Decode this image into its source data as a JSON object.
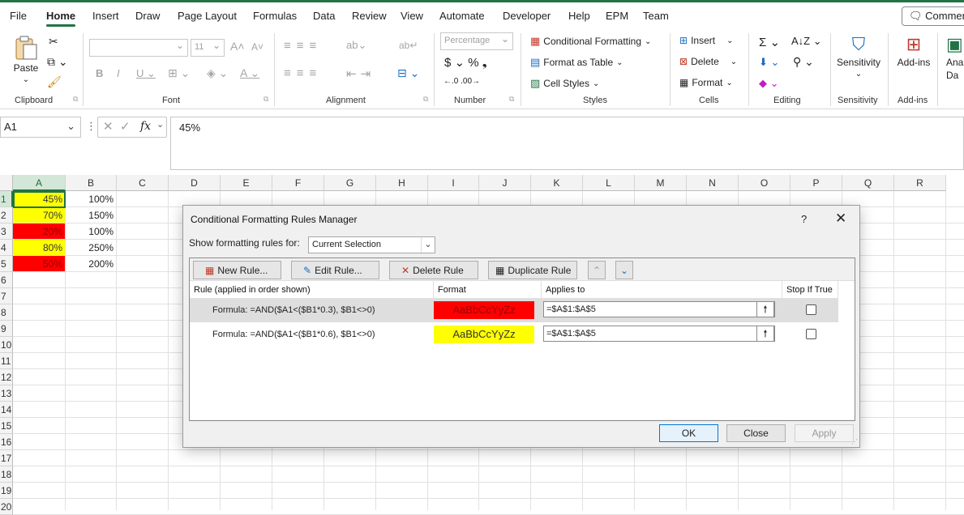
{
  "menu": {
    "tabs": [
      {
        "label": "File"
      },
      {
        "label": "Home"
      },
      {
        "label": "Insert"
      },
      {
        "label": "Draw"
      },
      {
        "label": "Page Layout"
      },
      {
        "label": "Formulas"
      },
      {
        "label": "Data"
      },
      {
        "label": "Review"
      },
      {
        "label": "View"
      },
      {
        "label": "Automate"
      },
      {
        "label": "Developer"
      },
      {
        "label": "Help"
      },
      {
        "label": "EPM"
      },
      {
        "label": "Team"
      }
    ],
    "active": "Home",
    "comments_label": "Comments"
  },
  "ribbon": {
    "clipboard": {
      "paste": "Paste",
      "label": "Clipboard"
    },
    "font": {
      "name": "",
      "size": "11",
      "label": "Font"
    },
    "alignment": {
      "label": "Alignment"
    },
    "number": {
      "format": "Percentage",
      "label": "Number"
    },
    "styles": {
      "conditional": "Conditional Formatting",
      "table": "Format as Table",
      "cell_styles": "Cell Styles",
      "label": "Styles"
    },
    "cells": {
      "insert": "Insert",
      "delete": "Delete",
      "format": "Format",
      "label": "Cells"
    },
    "editing": {
      "label": "Editing"
    },
    "sensitivity": {
      "btn": "Sensitivity",
      "label": "Sensitivity"
    },
    "addins": {
      "btn": "Add-ins",
      "label": "Add-ins"
    },
    "analyze": {
      "btn_line1": "Ana",
      "btn_line2": "Da"
    }
  },
  "formula_bar": {
    "name_box": "A1",
    "fx": "fx",
    "value": "45%"
  },
  "sheet": {
    "columns": [
      "A",
      "B",
      "C",
      "D",
      "E",
      "F",
      "G",
      "H",
      "I",
      "J",
      "K",
      "L",
      "M",
      "N",
      "O",
      "P",
      "Q",
      "R"
    ],
    "rows": [
      "1",
      "2",
      "3",
      "4",
      "5",
      "6",
      "7",
      "8",
      "9",
      "10",
      "11",
      "12",
      "13",
      "14",
      "15",
      "16",
      "17",
      "18",
      "19",
      "20"
    ],
    "cells_a": [
      "45%",
      "70%",
      "20%",
      "80%",
      "50%"
    ],
    "cells_b": [
      "100%",
      "150%",
      "100%",
      "250%",
      "200%"
    ],
    "fill_a": [
      "yellow",
      "yellow",
      "red",
      "yellow",
      "red"
    ]
  },
  "dialog": {
    "title": "Conditional Formatting Rules Manager",
    "help": "?",
    "show_label": "Show formatting rules for:",
    "show_value": "Current Selection",
    "buttons": {
      "new_rule": "New Rule...",
      "edit_rule": "Edit Rule...",
      "delete_rule": "Delete Rule",
      "duplicate_rule": "Duplicate Rule"
    },
    "headers": {
      "rule": "Rule (applied in order shown)",
      "format": "Format",
      "applies": "Applies to",
      "stop": "Stop If True"
    },
    "rules": [
      {
        "formula": "Formula: =AND($A1<($B1*0.3), $B1<>0)",
        "preview": "AaBbCcYyZz",
        "applies": "=$A$1:$A$5",
        "color": "#ff0000",
        "text_color": "#9c0006"
      },
      {
        "formula": "Formula: =AND($A1<($B1*0.6), $B1<>0)",
        "preview": "AaBbCcYyZz",
        "applies": "=$A$1:$A$5",
        "color": "#ffff00",
        "text_color": "#333333"
      }
    ],
    "ok": "OK",
    "close": "Close",
    "apply": "Apply"
  }
}
